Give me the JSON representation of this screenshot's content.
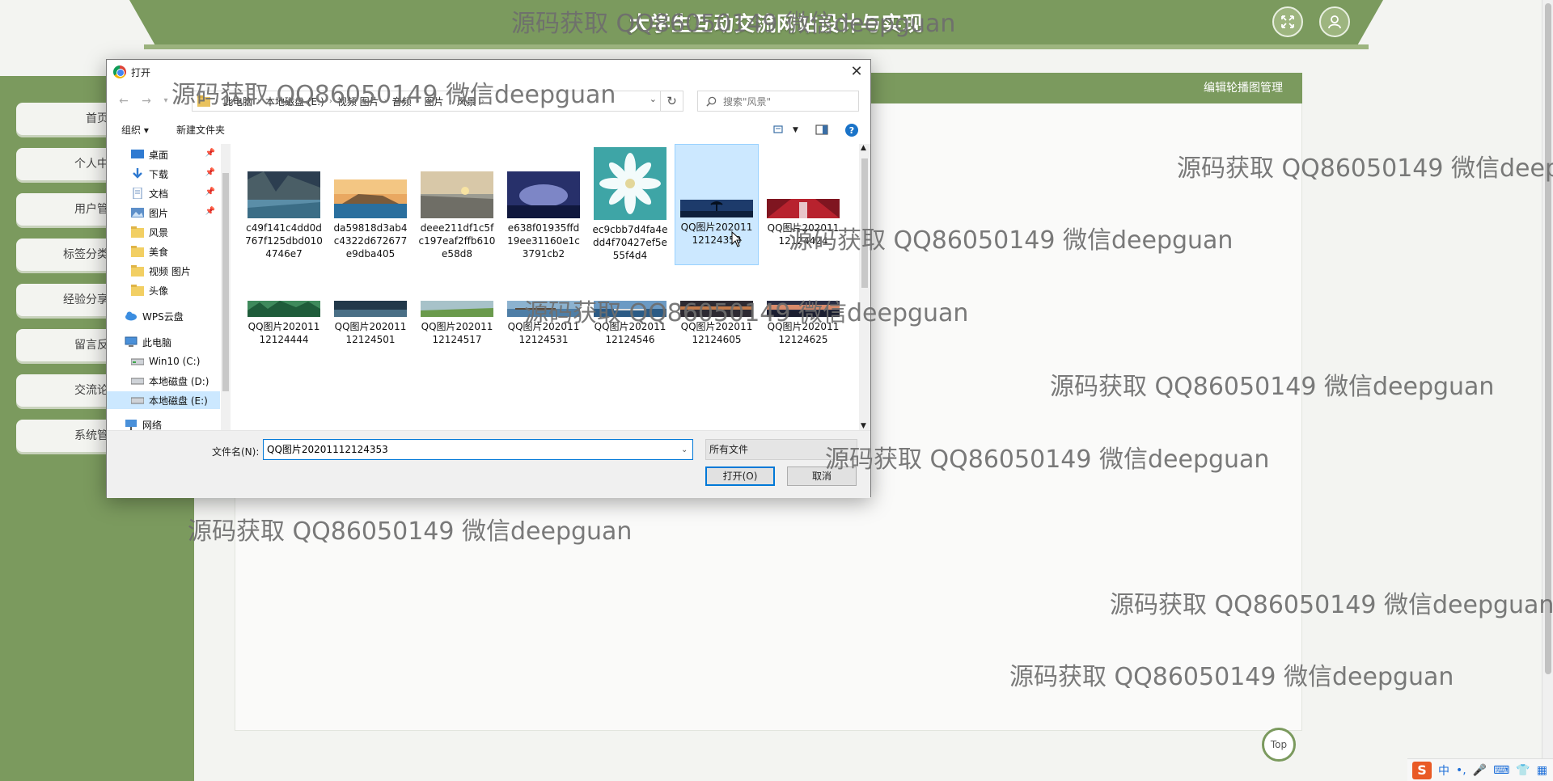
{
  "site": {
    "title": "大学生互动交流网站设计与实现",
    "content_header": "编辑轮播图管理",
    "top_button": "Top"
  },
  "sidebar": {
    "items": [
      {
        "label": "首页"
      },
      {
        "label": "个人中心"
      },
      {
        "label": "用户管理"
      },
      {
        "label": "标签分类管理"
      },
      {
        "label": "经验分享管理"
      },
      {
        "label": "留言反馈"
      },
      {
        "label": "交流论坛"
      },
      {
        "label": "系统管理"
      }
    ]
  },
  "dialog": {
    "title": "打开",
    "close_label": "✕",
    "breadcrumb": [
      "此电脑",
      "本地磁盘 (E:)",
      "视频 图片",
      "音频",
      "图片",
      "风景"
    ],
    "search_placeholder": "搜索\"风景\"",
    "toolbar": {
      "organize": "组织 ▾",
      "new_folder": "新建文件夹"
    },
    "nav_items": [
      {
        "label": "桌面",
        "icon": "desktop-icon",
        "pinned": true
      },
      {
        "label": "下载",
        "icon": "download-icon",
        "pinned": true
      },
      {
        "label": "文档",
        "icon": "document-icon",
        "pinned": true
      },
      {
        "label": "图片",
        "icon": "picture-icon",
        "pinned": true
      },
      {
        "label": "风景",
        "icon": "folder-icon",
        "pinned": false
      },
      {
        "label": "美食",
        "icon": "folder-icon",
        "pinned": false
      },
      {
        "label": "视频 图片",
        "icon": "folder-icon",
        "pinned": false
      },
      {
        "label": "头像",
        "icon": "folder-icon",
        "pinned": false
      },
      {
        "label": "WPS云盘",
        "icon": "cloud-icon",
        "pinned": false
      },
      {
        "label": "此电脑",
        "icon": "computer-icon",
        "pinned": false
      },
      {
        "label": "Win10 (C:)",
        "icon": "drive-icon",
        "pinned": false
      },
      {
        "label": "本地磁盘 (D:)",
        "icon": "drive-icon",
        "pinned": false
      },
      {
        "label": "本地磁盘 (E:)",
        "icon": "drive-icon",
        "pinned": false,
        "selected": true
      },
      {
        "label": "网络",
        "icon": "network-icon",
        "pinned": false
      }
    ],
    "files": [
      {
        "name": "c49f141c4dd0d767f125dbd0104746e7",
        "thumb": "river-mountain"
      },
      {
        "name": "da59818d3ab4c4322d672677e9dba405",
        "thumb": "lake-island"
      },
      {
        "name": "deee211df1c5fc197eaf2ffb610e58d8",
        "thumb": "sunset-shore"
      },
      {
        "name": "e638f01935ffd19ee31160e1c3791cb2",
        "thumb": "purple-sky"
      },
      {
        "name": "ec9cbb7d4fa4edd4f70427ef5e55f4d4",
        "thumb": "white-flower"
      },
      {
        "name": "QQ图片20201112124353",
        "thumb": "lone-tree",
        "selected": true
      },
      {
        "name": "QQ图片20201112124424",
        "thumb": "red-forest"
      },
      {
        "name": "QQ图片20201112124444",
        "thumb": "green-karst"
      },
      {
        "name": "QQ图片20201112124501",
        "thumb": "dark-lake"
      },
      {
        "name": "QQ图片20201112124517",
        "thumb": "green-field"
      },
      {
        "name": "QQ图片20201112124531",
        "thumb": "pier-dusk"
      },
      {
        "name": "QQ图片20201112124546",
        "thumb": "dock-blue"
      },
      {
        "name": "QQ图片20201112124605",
        "thumb": "dark-sunset"
      },
      {
        "name": "QQ图片20201112124625",
        "thumb": "pink-sunset"
      }
    ],
    "filename_label": "文件名(N):",
    "filename_value": "QQ图片20201112124353",
    "filetype": "所有文件",
    "open_button": "打开(O)",
    "cancel_button": "取消"
  },
  "watermark": "源码获取 QQ86050149 微信deepguan",
  "ime": {
    "lang": "中",
    "punct": "•,"
  }
}
